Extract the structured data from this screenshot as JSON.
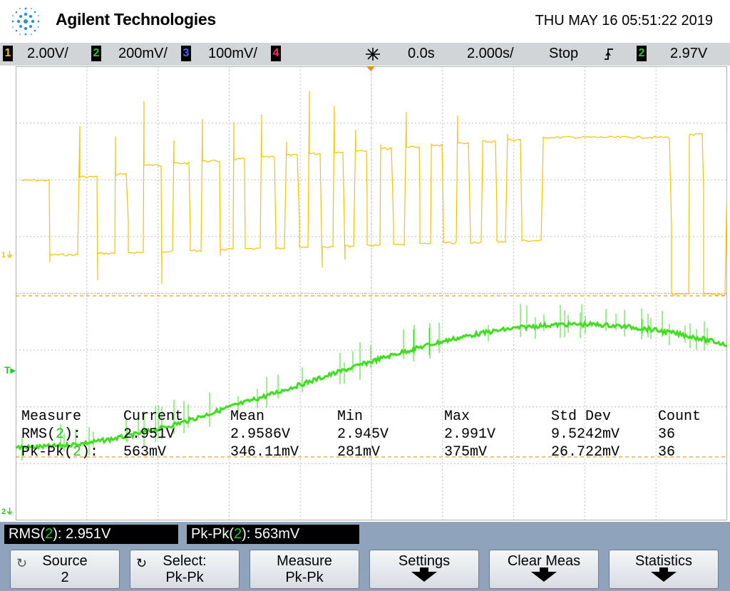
{
  "header": {
    "brand": "Agilent Technologies",
    "datetime": "THU MAY 16 05:51:22 2019"
  },
  "statusbar": {
    "ch1": {
      "num": "1",
      "scale": "2.00V/",
      "color": "#f2c200"
    },
    "ch2": {
      "num": "2",
      "scale": "200mV/",
      "color": "#22cc22"
    },
    "ch3": {
      "num": "3",
      "scale": "100mV/",
      "color": "#4466ff"
    },
    "ch4": {
      "num": "4",
      "color": "#ff2a6a"
    },
    "delay": "0.0s",
    "timebase": "2.000s/",
    "run_state": "Stop",
    "trigger_channel": "2",
    "trigger_level": "2.97V"
  },
  "markers": {
    "ch1": "1",
    "trigger": "T",
    "ch2": "2"
  },
  "measurements": {
    "headers": [
      "Measure",
      "Current",
      "Mean",
      "Min",
      "Max",
      "Std Dev",
      "Count"
    ],
    "rows": [
      {
        "name_prefix": "RMS(",
        "channel": "2",
        "name_suffix": "):",
        "current": "2.951V",
        "mean": "2.9586V",
        "min": "2.945V",
        "max": "2.991V",
        "std_dev": "9.5242mV",
        "count": "36"
      },
      {
        "name_prefix": "Pk-Pk(",
        "channel": "2",
        "name_suffix": "):",
        "current": "563mV",
        "mean": "346.11mV",
        "min": "281mV",
        "max": "375mV",
        "std_dev": "26.722mV",
        "count": "36"
      }
    ]
  },
  "measbar": {
    "rms": {
      "prefix": "RMS(",
      "channel": "2",
      "suffix": "): 2.951V"
    },
    "pkpk": {
      "prefix": "Pk-Pk(",
      "channel": "2",
      "suffix": "): 563mV"
    }
  },
  "softkeys": [
    {
      "label": "Source",
      "value": "2"
    },
    {
      "label": "Select:",
      "value": "Pk-Pk"
    },
    {
      "label": "Measure",
      "value": "Pk-Pk"
    },
    {
      "label": "Settings",
      "value": ""
    },
    {
      "label": "Clear Meas",
      "value": ""
    },
    {
      "label": "Statistics",
      "value": ""
    }
  ],
  "colors": {
    "ch1_trace": "#f2c200",
    "ch2_trace": "#3ddf1f",
    "softkey_bar": "#8fa3bd",
    "status_bar": "#d2d5d8"
  }
}
